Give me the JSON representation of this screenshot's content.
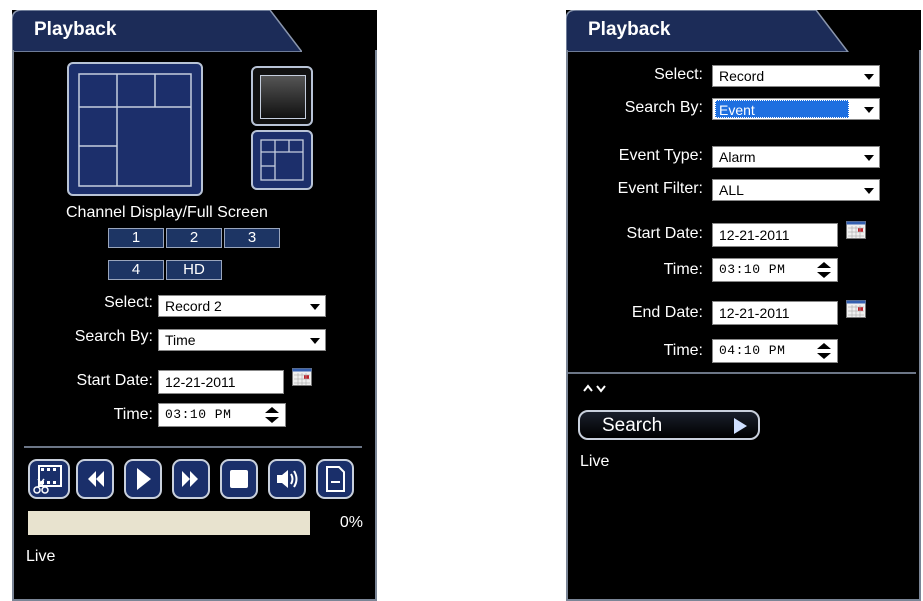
{
  "left_panel": {
    "tab_title": "Playback",
    "channel_display_label": "Channel Display/Full Screen",
    "channels": [
      "1",
      "2",
      "3",
      "4",
      "HD"
    ],
    "select_label": "Select:",
    "select_value": "Record 2",
    "search_by_label": "Search By:",
    "search_by_value": "Time",
    "start_date_label": "Start Date:",
    "start_date_value": "12-21-2011",
    "time_label": "Time:",
    "time_value": "03:10 PM",
    "controls": [
      "clip-icon",
      "rewind-icon",
      "play-icon",
      "fast-forward-icon",
      "stop-icon",
      "audio-icon",
      "export-icon"
    ],
    "progress": 0,
    "progress_text": "0%",
    "status_text": "Live"
  },
  "right_panel": {
    "tab_title": "Playback",
    "select_label": "Select:",
    "select_value": "Record",
    "search_by_label": "Search By:",
    "search_by_value": "Event",
    "event_type_label": "Event Type:",
    "event_type_value": "Alarm",
    "event_filter_label": "Event Filter:",
    "event_filter_value": "ALL",
    "start_date_label": "Start Date:",
    "start_date_value": "12-21-2011",
    "start_time_label": "Time:",
    "start_time_value": "03:10 PM",
    "end_date_label": "End Date:",
    "end_date_value": "12-21-2011",
    "end_time_label": "Time:",
    "end_time_value": "04:10 PM",
    "search_button_label": "Search",
    "status_text": "Live"
  },
  "colors": {
    "panel_bg": "#000000",
    "tab_bg": "#1c2c58",
    "highlight": "#1e6fe0",
    "progress_track": "#e8e3cf"
  }
}
